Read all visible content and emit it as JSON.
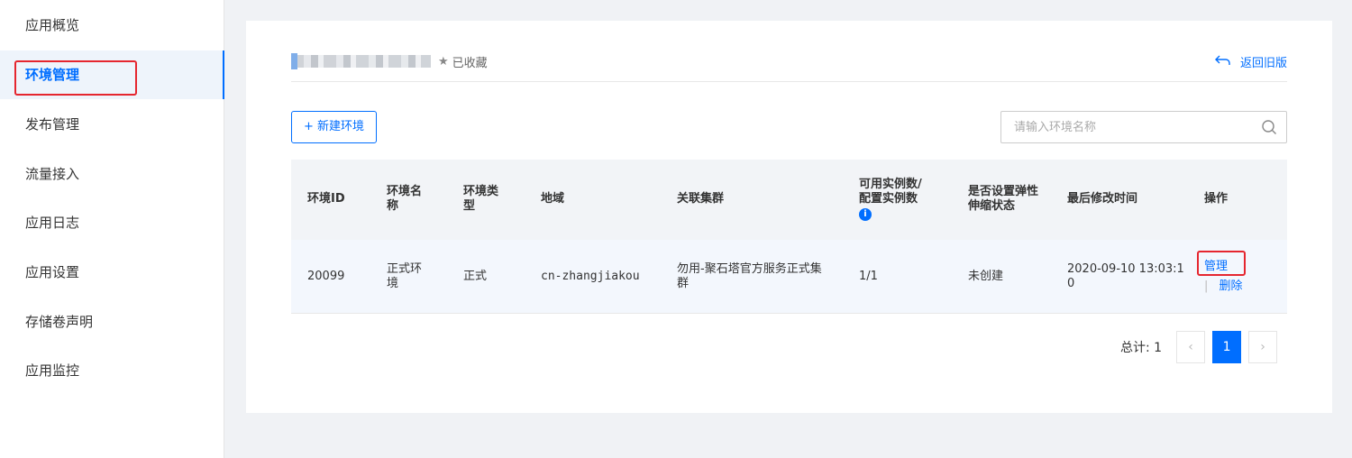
{
  "sidebar": {
    "items": [
      {
        "label": "应用概览"
      },
      {
        "label": "环境管理"
      },
      {
        "label": "发布管理"
      },
      {
        "label": "流量接入"
      },
      {
        "label": "应用日志"
      },
      {
        "label": "应用设置"
      },
      {
        "label": "存储卷声明"
      },
      {
        "label": "应用监控"
      }
    ],
    "active_index": 1
  },
  "header": {
    "favorite_label": "已收藏",
    "back_label": "返回旧版",
    "star_icon": "star-icon",
    "back_icon": "return-arrow-icon"
  },
  "toolbar": {
    "new_button_label": "+ 新建环境",
    "search_placeholder": "请输入环境名称",
    "search_icon": "search-icon"
  },
  "table": {
    "columns": [
      "环境ID",
      "环境名称",
      "环境类型",
      "地域",
      "关联集群",
      "可用实例数/配置实例数",
      "是否设置弹性伸缩状态",
      "最后修改时间",
      "操作"
    ],
    "info_icon_label": "i",
    "rows": [
      {
        "id": "20099",
        "name": "正式环境",
        "type": "正式",
        "region": "cn-zhangjiakou",
        "cluster": "勿用-聚石塔官方服务正式集群",
        "instances": "1/1",
        "autoscale": "未创建",
        "modified": "2020-09-10 13:03:10",
        "action_manage": "管理",
        "action_sep": "|",
        "action_delete": "删除"
      }
    ]
  },
  "pagination": {
    "total_label": "总计: 1",
    "prev": "‹",
    "current_page": "1",
    "next": "›"
  },
  "colors": {
    "accent": "#006eff",
    "highlight": "#e5262f"
  }
}
